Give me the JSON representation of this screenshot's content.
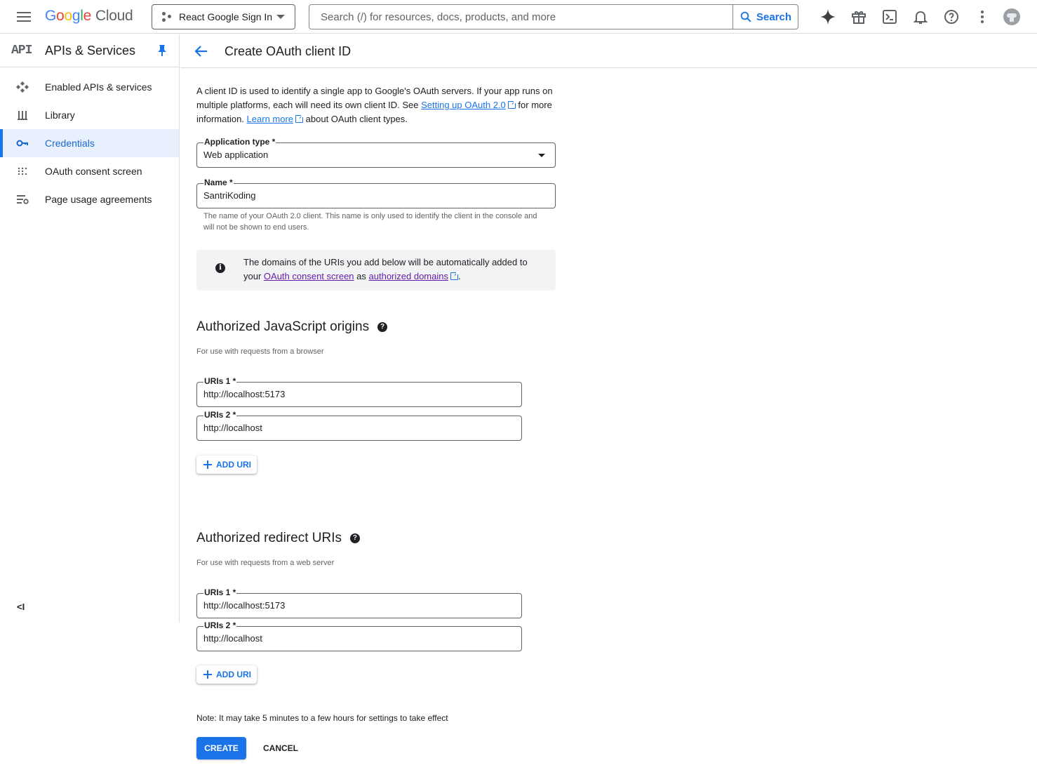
{
  "topbar": {
    "logo_letters": [
      "G",
      "o",
      "o",
      "g",
      "l",
      "e"
    ],
    "logo_product": "Cloud",
    "project_name": "React Google Sign In",
    "search_placeholder": "Search (/) for resources, docs, products, and more",
    "search_button": "Search",
    "icons": [
      "gemini-sparkle-icon",
      "gift-icon",
      "cloud-shell-icon",
      "notifications-bell-icon",
      "help-icon",
      "more-vert-icon",
      "account-avatar"
    ]
  },
  "sidebar": {
    "logo_text": "API",
    "title": "APIs & Services",
    "items": [
      {
        "label": "Enabled APIs & services",
        "icon": "enabled-apis-icon",
        "active": false
      },
      {
        "label": "Library",
        "icon": "library-icon",
        "active": false
      },
      {
        "label": "Credentials",
        "icon": "key-icon",
        "active": true
      },
      {
        "label": "OAuth consent screen",
        "icon": "consent-screen-icon",
        "active": false
      },
      {
        "label": "Page usage agreements",
        "icon": "page-settings-icon",
        "active": false
      }
    ],
    "collapse_label": "<I"
  },
  "main": {
    "title": "Create OAuth client ID",
    "intro": {
      "part1": "A client ID is used to identify a single app to Google's OAuth servers. If your app runs on multiple platforms, each will need its own client ID. See ",
      "link1": "Setting up OAuth 2.0",
      "part2": " for more information. ",
      "link2": "Learn more",
      "part3": " about OAuth client types."
    },
    "app_type": {
      "label": "Application type *",
      "value": "Web application"
    },
    "name": {
      "label": "Name *",
      "value": "SantriKoding",
      "helper": "The name of your OAuth 2.0 client. This name is only used to identify the client in the console and will not be shown to end users."
    },
    "info": {
      "part1": "The domains of the URIs you add below will be automatically added to your ",
      "link1": "OAuth consent screen",
      "part2": " as ",
      "link2": "authorized domains",
      "part3": "."
    },
    "js_origins": {
      "title": "Authorized JavaScript origins",
      "subtitle": "For use with requests from a browser",
      "uris": [
        {
          "label": "URIs 1 *",
          "value": "http://localhost:5173"
        },
        {
          "label": "URIs 2 *",
          "value": "http://localhost"
        }
      ],
      "add_label": "ADD URI"
    },
    "redirect_uris": {
      "title": "Authorized redirect URIs",
      "subtitle": "For use with requests from a web server",
      "uris": [
        {
          "label": "URIs 1 *",
          "value": "http://localhost:5173"
        },
        {
          "label": "URIs 2 *",
          "value": "http://localhost"
        }
      ],
      "add_label": "ADD URI"
    },
    "note": "Note: It may take 5 minutes to a few hours for settings to take effect",
    "create_label": "CREATE",
    "cancel_label": "CANCEL"
  },
  "colors": {
    "accent": "#1a73e8",
    "active_bg": "#e8f0fe",
    "link_visited": "#681da8"
  }
}
